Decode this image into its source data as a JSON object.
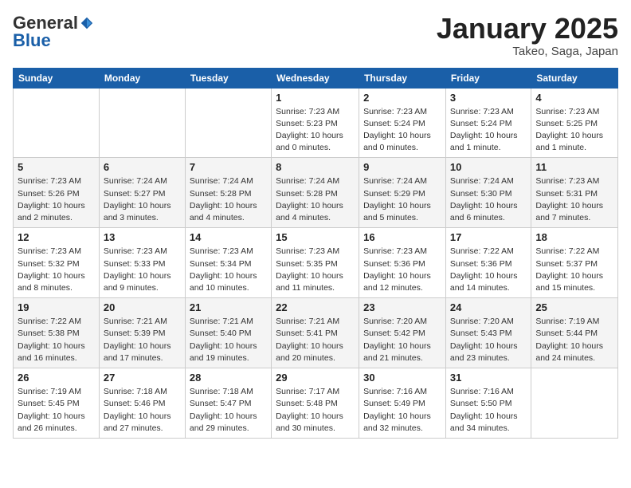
{
  "header": {
    "logo_general": "General",
    "logo_blue": "Blue",
    "title": "January 2025",
    "subtitle": "Takeo, Saga, Japan"
  },
  "weekdays": [
    "Sunday",
    "Monday",
    "Tuesday",
    "Wednesday",
    "Thursday",
    "Friday",
    "Saturday"
  ],
  "weeks": [
    [
      {
        "day": "",
        "info": ""
      },
      {
        "day": "",
        "info": ""
      },
      {
        "day": "",
        "info": ""
      },
      {
        "day": "1",
        "info": "Sunrise: 7:23 AM\nSunset: 5:23 PM\nDaylight: 10 hours\nand 0 minutes."
      },
      {
        "day": "2",
        "info": "Sunrise: 7:23 AM\nSunset: 5:24 PM\nDaylight: 10 hours\nand 0 minutes."
      },
      {
        "day": "3",
        "info": "Sunrise: 7:23 AM\nSunset: 5:24 PM\nDaylight: 10 hours\nand 1 minute."
      },
      {
        "day": "4",
        "info": "Sunrise: 7:23 AM\nSunset: 5:25 PM\nDaylight: 10 hours\nand 1 minute."
      }
    ],
    [
      {
        "day": "5",
        "info": "Sunrise: 7:23 AM\nSunset: 5:26 PM\nDaylight: 10 hours\nand 2 minutes."
      },
      {
        "day": "6",
        "info": "Sunrise: 7:24 AM\nSunset: 5:27 PM\nDaylight: 10 hours\nand 3 minutes."
      },
      {
        "day": "7",
        "info": "Sunrise: 7:24 AM\nSunset: 5:28 PM\nDaylight: 10 hours\nand 4 minutes."
      },
      {
        "day": "8",
        "info": "Sunrise: 7:24 AM\nSunset: 5:28 PM\nDaylight: 10 hours\nand 4 minutes."
      },
      {
        "day": "9",
        "info": "Sunrise: 7:24 AM\nSunset: 5:29 PM\nDaylight: 10 hours\nand 5 minutes."
      },
      {
        "day": "10",
        "info": "Sunrise: 7:24 AM\nSunset: 5:30 PM\nDaylight: 10 hours\nand 6 minutes."
      },
      {
        "day": "11",
        "info": "Sunrise: 7:23 AM\nSunset: 5:31 PM\nDaylight: 10 hours\nand 7 minutes."
      }
    ],
    [
      {
        "day": "12",
        "info": "Sunrise: 7:23 AM\nSunset: 5:32 PM\nDaylight: 10 hours\nand 8 minutes."
      },
      {
        "day": "13",
        "info": "Sunrise: 7:23 AM\nSunset: 5:33 PM\nDaylight: 10 hours\nand 9 minutes."
      },
      {
        "day": "14",
        "info": "Sunrise: 7:23 AM\nSunset: 5:34 PM\nDaylight: 10 hours\nand 10 minutes."
      },
      {
        "day": "15",
        "info": "Sunrise: 7:23 AM\nSunset: 5:35 PM\nDaylight: 10 hours\nand 11 minutes."
      },
      {
        "day": "16",
        "info": "Sunrise: 7:23 AM\nSunset: 5:36 PM\nDaylight: 10 hours\nand 12 minutes."
      },
      {
        "day": "17",
        "info": "Sunrise: 7:22 AM\nSunset: 5:36 PM\nDaylight: 10 hours\nand 14 minutes."
      },
      {
        "day": "18",
        "info": "Sunrise: 7:22 AM\nSunset: 5:37 PM\nDaylight: 10 hours\nand 15 minutes."
      }
    ],
    [
      {
        "day": "19",
        "info": "Sunrise: 7:22 AM\nSunset: 5:38 PM\nDaylight: 10 hours\nand 16 minutes."
      },
      {
        "day": "20",
        "info": "Sunrise: 7:21 AM\nSunset: 5:39 PM\nDaylight: 10 hours\nand 17 minutes."
      },
      {
        "day": "21",
        "info": "Sunrise: 7:21 AM\nSunset: 5:40 PM\nDaylight: 10 hours\nand 19 minutes."
      },
      {
        "day": "22",
        "info": "Sunrise: 7:21 AM\nSunset: 5:41 PM\nDaylight: 10 hours\nand 20 minutes."
      },
      {
        "day": "23",
        "info": "Sunrise: 7:20 AM\nSunset: 5:42 PM\nDaylight: 10 hours\nand 21 minutes."
      },
      {
        "day": "24",
        "info": "Sunrise: 7:20 AM\nSunset: 5:43 PM\nDaylight: 10 hours\nand 23 minutes."
      },
      {
        "day": "25",
        "info": "Sunrise: 7:19 AM\nSunset: 5:44 PM\nDaylight: 10 hours\nand 24 minutes."
      }
    ],
    [
      {
        "day": "26",
        "info": "Sunrise: 7:19 AM\nSunset: 5:45 PM\nDaylight: 10 hours\nand 26 minutes."
      },
      {
        "day": "27",
        "info": "Sunrise: 7:18 AM\nSunset: 5:46 PM\nDaylight: 10 hours\nand 27 minutes."
      },
      {
        "day": "28",
        "info": "Sunrise: 7:18 AM\nSunset: 5:47 PM\nDaylight: 10 hours\nand 29 minutes."
      },
      {
        "day": "29",
        "info": "Sunrise: 7:17 AM\nSunset: 5:48 PM\nDaylight: 10 hours\nand 30 minutes."
      },
      {
        "day": "30",
        "info": "Sunrise: 7:16 AM\nSunset: 5:49 PM\nDaylight: 10 hours\nand 32 minutes."
      },
      {
        "day": "31",
        "info": "Sunrise: 7:16 AM\nSunset: 5:50 PM\nDaylight: 10 hours\nand 34 minutes."
      },
      {
        "day": "",
        "info": ""
      }
    ]
  ]
}
